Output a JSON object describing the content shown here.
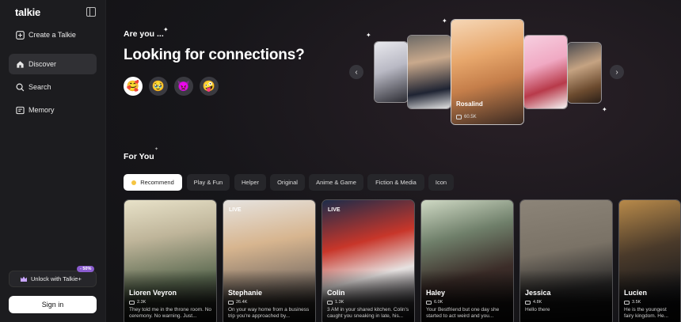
{
  "sidebar": {
    "logo": "talkie",
    "create_label": "Create a Talkie",
    "items": [
      {
        "label": "Discover",
        "icon": "home-icon"
      },
      {
        "label": "Search",
        "icon": "search-icon"
      },
      {
        "label": "Memory",
        "icon": "memory-icon"
      }
    ],
    "unlock_label": "Unlock with Talkie+",
    "discount_badge": "- 50%",
    "signin_label": "Sign in"
  },
  "hero": {
    "kicker": "Are you ...",
    "headline": "Looking for connections?",
    "emojis": [
      "🥰",
      "🥹",
      "👿",
      "🤪"
    ],
    "featured_name": "Rosalind",
    "featured_count": "60.5K"
  },
  "for_you": {
    "title": "For You",
    "tabs": [
      "Recommend",
      "Play & Fun",
      "Helper",
      "Original",
      "Anime & Game",
      "Fiction & Media",
      "Icon"
    ]
  },
  "cards": [
    {
      "name": "Lioren Veyron",
      "count": "2.3K",
      "live": "",
      "desc": "They told me in the throne room. No ceremony. No warning. Just..."
    },
    {
      "name": "Stephanie",
      "count": "26.4K",
      "live": "LIVE",
      "desc": "On your way home from a business trip you're approached by..."
    },
    {
      "name": "Colin",
      "count": "1.3K",
      "live": "LIVE",
      "desc": "3 AM in your shared kitchen. Colin's caught you sneaking in late, his..."
    },
    {
      "name": "Haley",
      "count": "6.0K",
      "live": "",
      "desc": "Your Bestfriend but one day she started to act weird and you..."
    },
    {
      "name": "Jessica",
      "count": "4.8K",
      "live": "",
      "desc": "Hello there"
    },
    {
      "name": "Lucien",
      "count": "3.5K",
      "live": "",
      "desc": "He is the youngest fairy kingdom. He..."
    }
  ],
  "colors": {
    "sidebar_bg": "#1c1c1f",
    "main_bg": "#121214",
    "accent_purple": "#8a5ccf",
    "recommend_dot": "#f5c542"
  }
}
